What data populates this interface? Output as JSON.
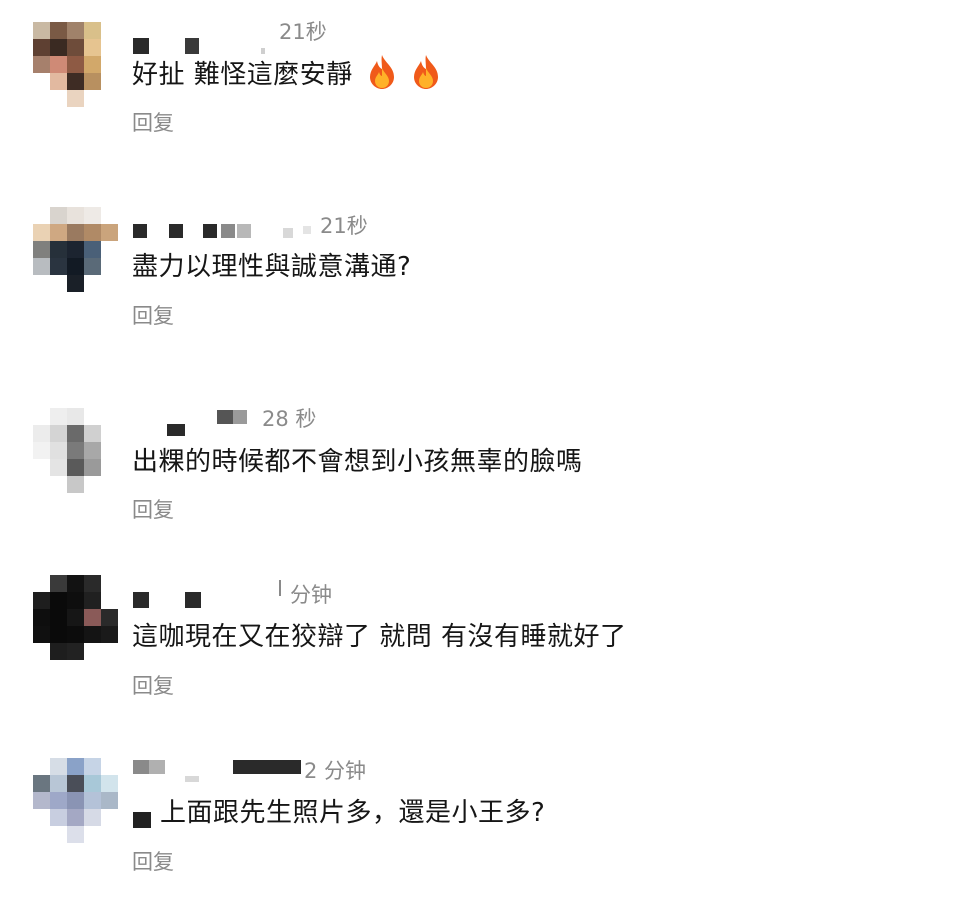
{
  "comments": [
    {
      "text": "好扯 難怪這麼安靜",
      "time": "21秒",
      "reply": "回复",
      "icons": [
        "fire-icon",
        "fire-icon"
      ]
    },
    {
      "text": "盡力以理性與誠意溝通?",
      "time": "21秒",
      "reply": "回复"
    },
    {
      "text": "出粿的時候都不會想到小孩無辜的臉嗎",
      "time": "28 秒",
      "reply": "回复"
    },
    {
      "text": "這咖現在又在狡辯了 就問 有沒有睡就好了",
      "time": "分钟",
      "reply": "回复"
    },
    {
      "text": "上面跟先生照片多，還是小王多?",
      "time": "2 分钟",
      "reply": "回复"
    }
  ]
}
